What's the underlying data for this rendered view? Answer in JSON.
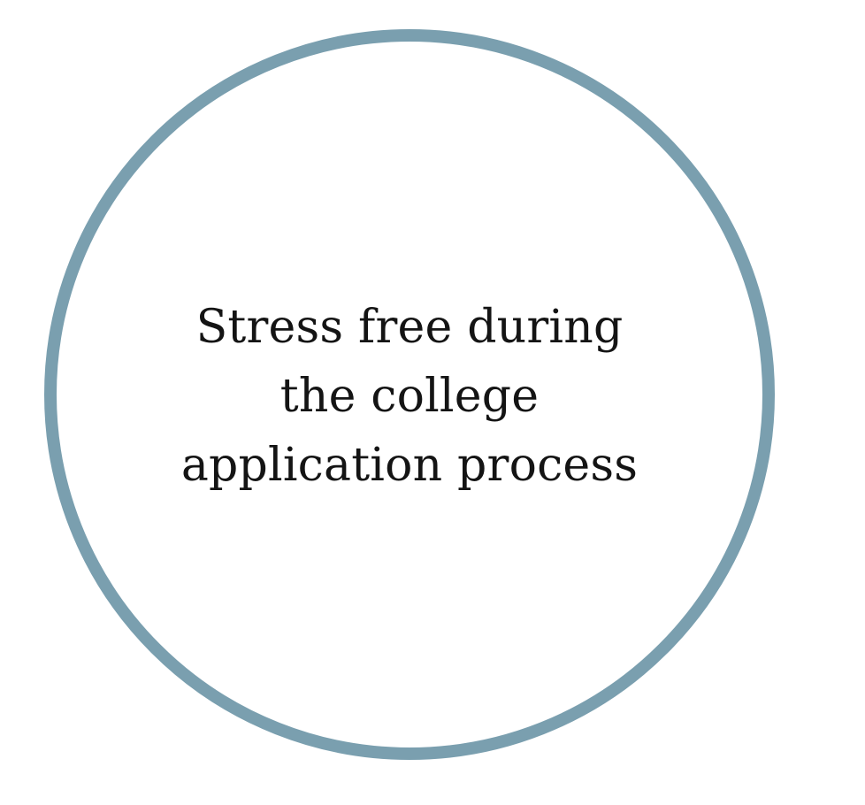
{
  "ring_color": "#7a9faf",
  "text_color": "#141414",
  "caption": {
    "line1": "Stress free during",
    "line2": "the college",
    "line3": "application process"
  }
}
